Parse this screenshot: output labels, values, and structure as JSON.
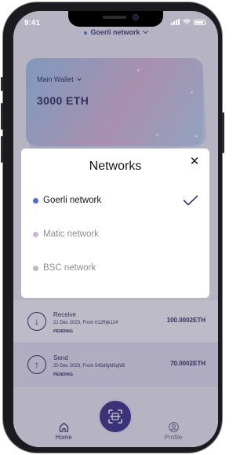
{
  "status_bar": {
    "time": "9:41"
  },
  "header": {
    "network_selector_label": "Goerli network"
  },
  "wallet_card": {
    "name": "Main Wallet",
    "balance": "3000 ETH"
  },
  "networks_modal": {
    "title": "Networks",
    "close_glyph": "✕",
    "items": [
      {
        "label": "Goerli network",
        "dot_color": "#4c6fd6",
        "selected": true
      },
      {
        "label": "Matic network",
        "dot_color": "#c9b3ec",
        "selected": false
      },
      {
        "label": "BSC network",
        "dot_color": "#bdbdbd",
        "selected": false
      }
    ]
  },
  "transactions": [
    {
      "type": "Receive",
      "icon": "arrow-down-icon",
      "meta": "21 Dec 2023, From 012fhjk124",
      "status": "PENDING",
      "amount": "100.0002ETH"
    },
    {
      "type": "Send",
      "icon": "arrow-up-icon",
      "meta": "20 Dec 2023, From 545dfgfd5gfd5",
      "status": "PENDING",
      "amount": "70.0002ETH"
    }
  ],
  "tab_bar": {
    "home_label": "Home",
    "profile_label": "Profile"
  },
  "colors": {
    "brand_purple": "#3d2f88",
    "text_navy": "#2f2b5e"
  }
}
